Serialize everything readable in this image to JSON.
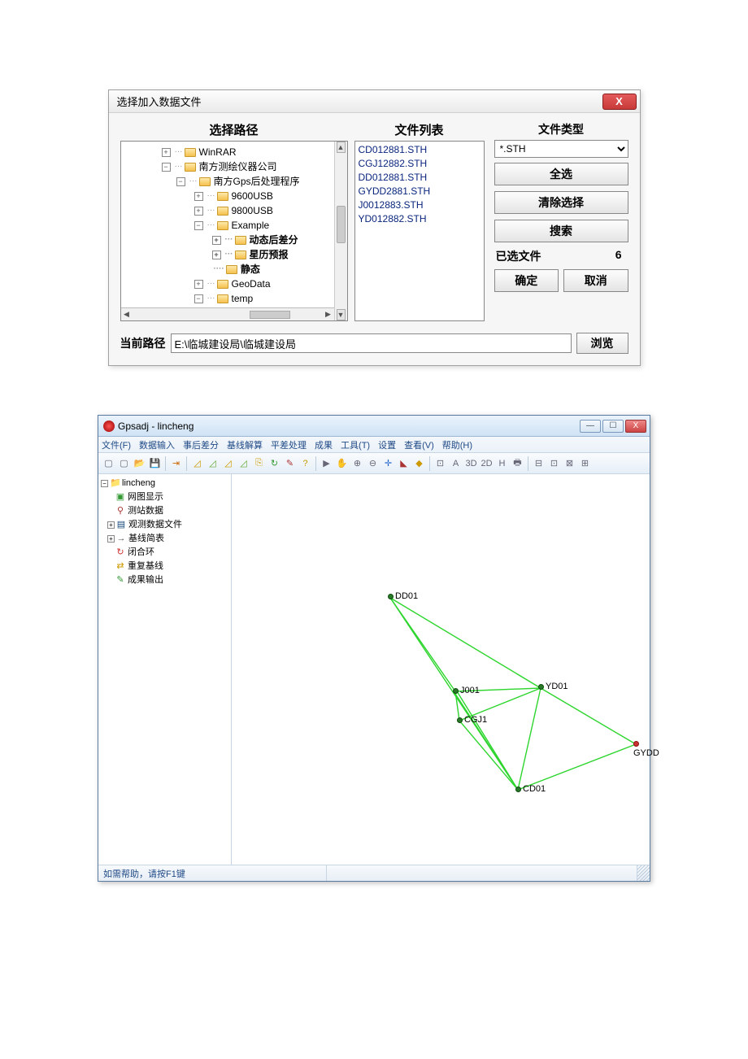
{
  "dialog1": {
    "title": "选择加入数据文件",
    "close_icon": "X",
    "path_header": "选择路径",
    "tree": {
      "n0": "WinRAR",
      "n1": "南方测绘仪器公司",
      "n2": "南方Gps后处理程序",
      "n3": "9600USB",
      "n4": "9800USB",
      "n5": "Example",
      "n6": "动态后差分",
      "n7": "星历预报",
      "n8": "静态",
      "n9": "GeoData",
      "n10": "temp"
    },
    "file_header": "文件列表",
    "files": [
      "CD012881.STH",
      "CGJ12882.STH",
      "DD012881.STH",
      "GYDD2881.STH",
      "J0012883.STH",
      "YD012882.STH"
    ],
    "ftype_header": "文件类型",
    "ftype_value": "*.STH",
    "btn_all": "全选",
    "btn_clear": "清除选择",
    "btn_search": "搜索",
    "sel_label": "已选文件",
    "sel_count": "6",
    "btn_ok": "确定",
    "btn_cancel": "取消",
    "cur_path_label": "当前路径",
    "cur_path_value": "E:\\临城建设局\\临城建设局",
    "btn_browse": "浏览"
  },
  "win2": {
    "title": "Gpsadj - lincheng",
    "menu": [
      "文件(F)",
      "数据输入",
      "事后差分",
      "基线解算",
      "平差处理",
      "成果",
      "工具(T)",
      "设置",
      "查看(V)",
      "帮助(H)"
    ],
    "toolbar_text": [
      "A",
      "3D",
      "2D",
      "H"
    ],
    "tree": {
      "root": "lincheng",
      "n1": "网图显示",
      "n2": "测站数据",
      "n3": "观测数据文件",
      "n4": "基线简表",
      "n5": "闭合环",
      "n6": "重复基线",
      "n7": "成果输出"
    },
    "nodes": {
      "dd01": "DD01",
      "j001": "J001",
      "yd01": "YD01",
      "cgj1": "CGJ1",
      "gydd": "GYDD",
      "cd01": "CD01"
    },
    "status": "如需帮助，请按F1键"
  }
}
